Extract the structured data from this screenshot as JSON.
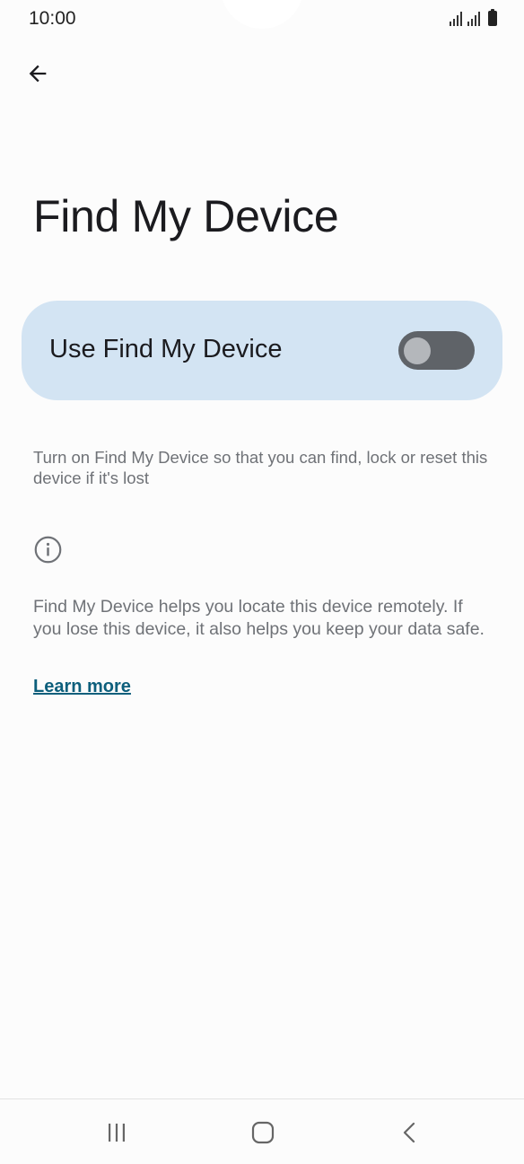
{
  "status_bar": {
    "time": "10:00",
    "icons": [
      "signal-icon",
      "signal-icon",
      "battery-icon"
    ]
  },
  "header": {
    "back_icon": "arrow-back-icon",
    "title": "Find My Device"
  },
  "main_switch": {
    "label": "Use Find My Device",
    "enabled": false
  },
  "description": "Turn on Find My Device so that you can find, lock or reset this device if it's lost",
  "footer": {
    "icon": "info-icon",
    "text": "Find My Device helps you locate this device remotely. If you lose this device, it also helps you keep your data safe.",
    "link_label": "Learn more"
  },
  "nav_bar": {
    "icons": [
      "recents-icon",
      "home-icon",
      "back-icon"
    ]
  },
  "colors": {
    "background": "#fcfcfc",
    "card": "#d3e4f3",
    "toggle_off": "#5f6368",
    "link": "#0d5f7c"
  }
}
